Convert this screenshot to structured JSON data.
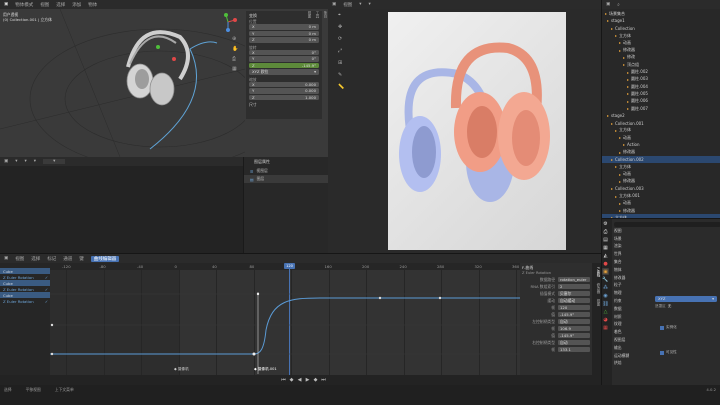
{
  "viewport3d": {
    "menus": [
      "视图",
      "选择",
      "添加",
      "物体"
    ],
    "mode": "物体模式",
    "info": [
      "用户透视",
      "(0) Collection.001 | 立方体"
    ]
  },
  "npanel": {
    "sections": [
      "变换",
      "位置",
      "旋转",
      "缩放",
      "尺寸"
    ],
    "loc": [
      "0 m",
      "0 m",
      "0 m"
    ],
    "rot": [
      "0°",
      "0°",
      "-145.9°"
    ],
    "rot_mode": "XYZ 欧拉",
    "scale": [
      "0.000",
      "0.000",
      "1.000"
    ],
    "tabs": [
      "条目",
      "工具",
      "视图"
    ]
  },
  "camera_view": {
    "title": "视图"
  },
  "render": {
    "accent1": "#e8927a",
    "accent2": "#a9b6e6"
  },
  "outliner": {
    "rows": [
      {
        "text": "场景集合",
        "indent": 0,
        "sel": false
      },
      {
        "text": "stage1",
        "indent": 2,
        "sel": false
      },
      {
        "text": "Collection",
        "indent": 6,
        "sel": false
      },
      {
        "text": "立方体",
        "indent": 10,
        "sel": false
      },
      {
        "text": "动画",
        "indent": 14,
        "sel": false
      },
      {
        "text": "修改器",
        "indent": 14,
        "sel": false
      },
      {
        "text": "修改",
        "indent": 18,
        "sel": false
      },
      {
        "text": "顶点组",
        "indent": 18,
        "sel": false
      },
      {
        "text": "圆柱.002",
        "indent": 22,
        "sel": false
      },
      {
        "text": "圆柱.003",
        "indent": 22,
        "sel": false
      },
      {
        "text": "圆柱.004",
        "indent": 22,
        "sel": false
      },
      {
        "text": "圆柱.005",
        "indent": 22,
        "sel": false
      },
      {
        "text": "圆柱.006",
        "indent": 22,
        "sel": false
      },
      {
        "text": "圆柱.007",
        "indent": 22,
        "sel": false
      },
      {
        "text": "stage2",
        "indent": 2,
        "sel": false
      },
      {
        "text": "Collection.001",
        "indent": 6,
        "sel": false
      },
      {
        "text": "立方体",
        "indent": 10,
        "sel": false
      },
      {
        "text": "动画",
        "indent": 14,
        "sel": false
      },
      {
        "text": "Action",
        "indent": 18,
        "sel": false
      },
      {
        "text": "修改器",
        "indent": 14,
        "sel": false
      },
      {
        "text": "Collection.002",
        "indent": 6,
        "sel": true
      },
      {
        "text": "立方体",
        "indent": 10,
        "sel": false
      },
      {
        "text": "动画",
        "indent": 14,
        "sel": false
      },
      {
        "text": "修改器",
        "indent": 14,
        "sel": false
      },
      {
        "text": "Collection.003",
        "indent": 6,
        "sel": false
      },
      {
        "text": "立方体.001",
        "indent": 10,
        "sel": false
      },
      {
        "text": "动画",
        "indent": 14,
        "sel": false
      },
      {
        "text": "修改器",
        "indent": 14,
        "sel": false
      },
      {
        "text": "立方体",
        "indent": 6,
        "sel": true
      }
    ]
  },
  "props": {
    "rows": [
      "视图",
      "场景",
      "渲染",
      "世界",
      "集合",
      "物体",
      "修改器",
      "粒子",
      "物理",
      "约束",
      "数据",
      "材质",
      "纹理",
      "着色",
      "视图层",
      "输出",
      "运动模糊",
      "烘焙"
    ],
    "sel_value": "XYZ",
    "sub_label": "遮罩区",
    "sub_value": "无",
    "checkbox1": "实例化",
    "checkbox2": "可见性"
  },
  "midpanel": {
    "title": "图层属性",
    "items": [
      "视图层",
      "图层"
    ]
  },
  "graph": {
    "menus": [
      "视图",
      "选择",
      "标记",
      "通道",
      "键"
    ],
    "mode": "曲线编辑器",
    "ticks": [
      "-120",
      "-80",
      "-40",
      "0",
      "40",
      "80",
      "120",
      "160",
      "200",
      "240",
      "280",
      "320",
      "360"
    ],
    "frame": "120",
    "channels": [
      "Cube",
      "Z Euler Rotation",
      "Cube",
      "Z Euler Rotation",
      "Cube",
      "Z Euler Rotation"
    ],
    "markers": [
      "摄像机",
      "摄像机.001"
    ],
    "fcurve_title": "F-曲线",
    "fcurve_rows": [
      {
        "label": "数据路径",
        "value": "rotation_euler"
      },
      {
        "label": "RNA 数组索引",
        "value": "2"
      },
      {
        "label": "插值模式",
        "value": "贝塞尔"
      },
      {
        "label": "缓动",
        "value": "自动缓动"
      },
      {
        "label": "帧",
        "value": "120"
      },
      {
        "label": "值",
        "value": "-145.9°"
      },
      {
        "label": "左控制柄类型",
        "value": "自动"
      },
      {
        "label": "帧",
        "value": "106.9"
      },
      {
        "label": "值",
        "value": "-145.9°"
      },
      {
        "label": "右控制柄类型",
        "value": "自动"
      },
      {
        "label": "帧",
        "value": "133.1"
      }
    ],
    "side_tabs": [
      "F-曲线",
      "修改器",
      "视图"
    ]
  },
  "statusbar": {
    "left": [
      "选择",
      "平移视图",
      "上下文菜单"
    ],
    "right": "4.0.2"
  }
}
